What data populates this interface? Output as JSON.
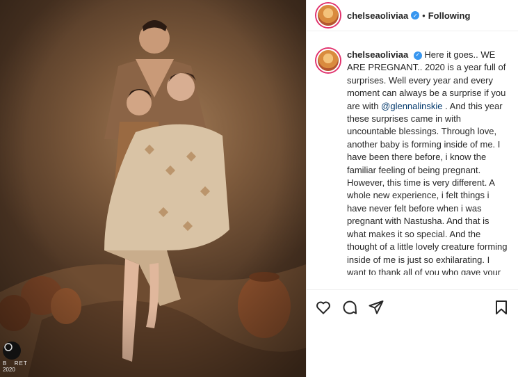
{
  "post": {
    "username": "chelseaoliviaa",
    "verified_icon": "verified-badge-icon",
    "follow_state": "Following",
    "separator": "•"
  },
  "caption": {
    "username": "chelseaoliviaa",
    "text_before_mention": "Here it goes.. WE ARE PREGNANT.. 2020 is a year full of surprises. Well every year and every moment can always be a surprise if you are with",
    "mention": "@glennalinskie",
    "text_after_mention": ". And this year these surprises came in with uncountable blessings. Through love, another baby is forming inside of me. I have been there before, i know the familiar feeling of being pregnant. However, this time is very different. A whole new experience, i felt things i have never felt before when i was pregnant with Nastusha. And that is what makes it so special. And the thought of a little lovely creature forming inside of me is just so exhilarating. I want to thank all of you who gave your best wishes to our"
  },
  "watermark": {
    "text": "B    RET",
    "year": "2020"
  },
  "icons": {
    "like": "heart-icon",
    "comment": "comment-icon",
    "share": "paper-plane-icon",
    "save": "bookmark-icon"
  },
  "colors": {
    "verified": "#3897f0",
    "mention": "#00376b",
    "text": "#262626",
    "border": "#efefef"
  }
}
